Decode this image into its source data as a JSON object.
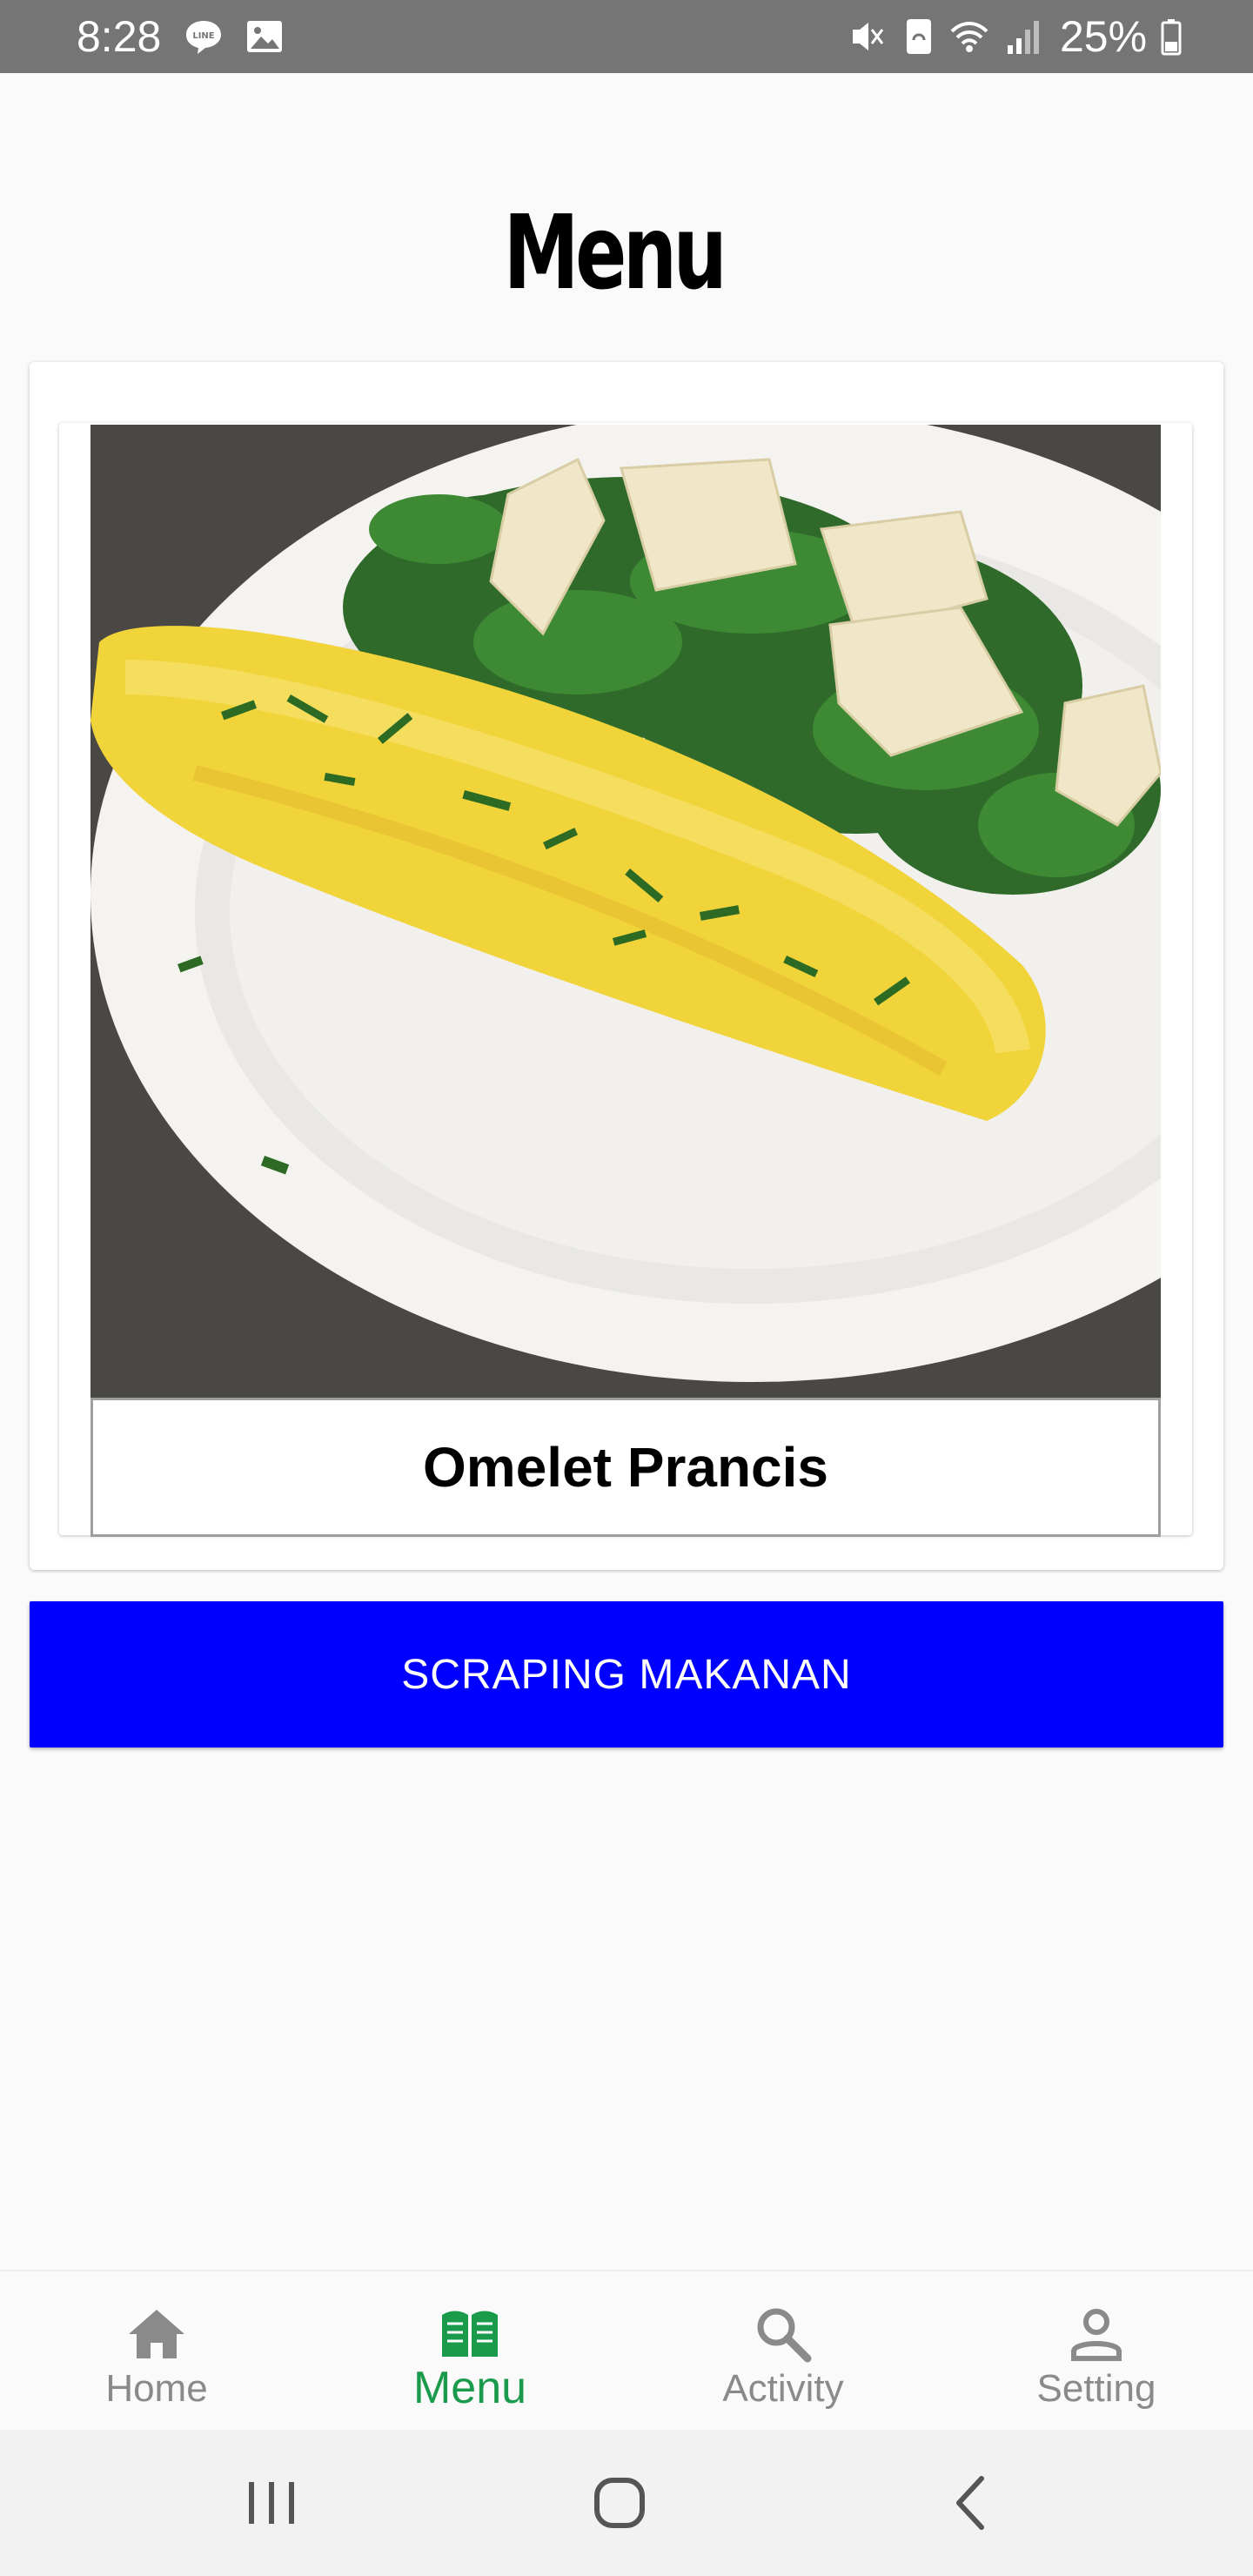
{
  "status_bar": {
    "time": "8:28",
    "battery": "25%",
    "icons": [
      "line-icon",
      "gallery-icon",
      "mute-icon",
      "nfc-icon",
      "wifi-icon",
      "signal-icon",
      "battery-icon"
    ]
  },
  "page": {
    "title": "Menu"
  },
  "menu_item": {
    "name": "Omelet Prancis",
    "image": "omelet-photo"
  },
  "actions": {
    "scrape_label": "SCRAPING MAKANAN"
  },
  "bottom_nav": {
    "items": [
      {
        "label": "Home",
        "icon": "home-icon",
        "active": false
      },
      {
        "label": "Menu",
        "icon": "book-icon",
        "active": true
      },
      {
        "label": "Activity",
        "icon": "search-icon",
        "active": false
      },
      {
        "label": "Setting",
        "icon": "person-icon",
        "active": false
      }
    ]
  },
  "system_nav": {
    "buttons": [
      "recents-icon",
      "home-circle-icon",
      "back-icon"
    ]
  },
  "colors": {
    "accent": "#1a9b4b",
    "button": "#0000ff",
    "status_bar": "#757575",
    "inactive": "#8a8a8a"
  }
}
